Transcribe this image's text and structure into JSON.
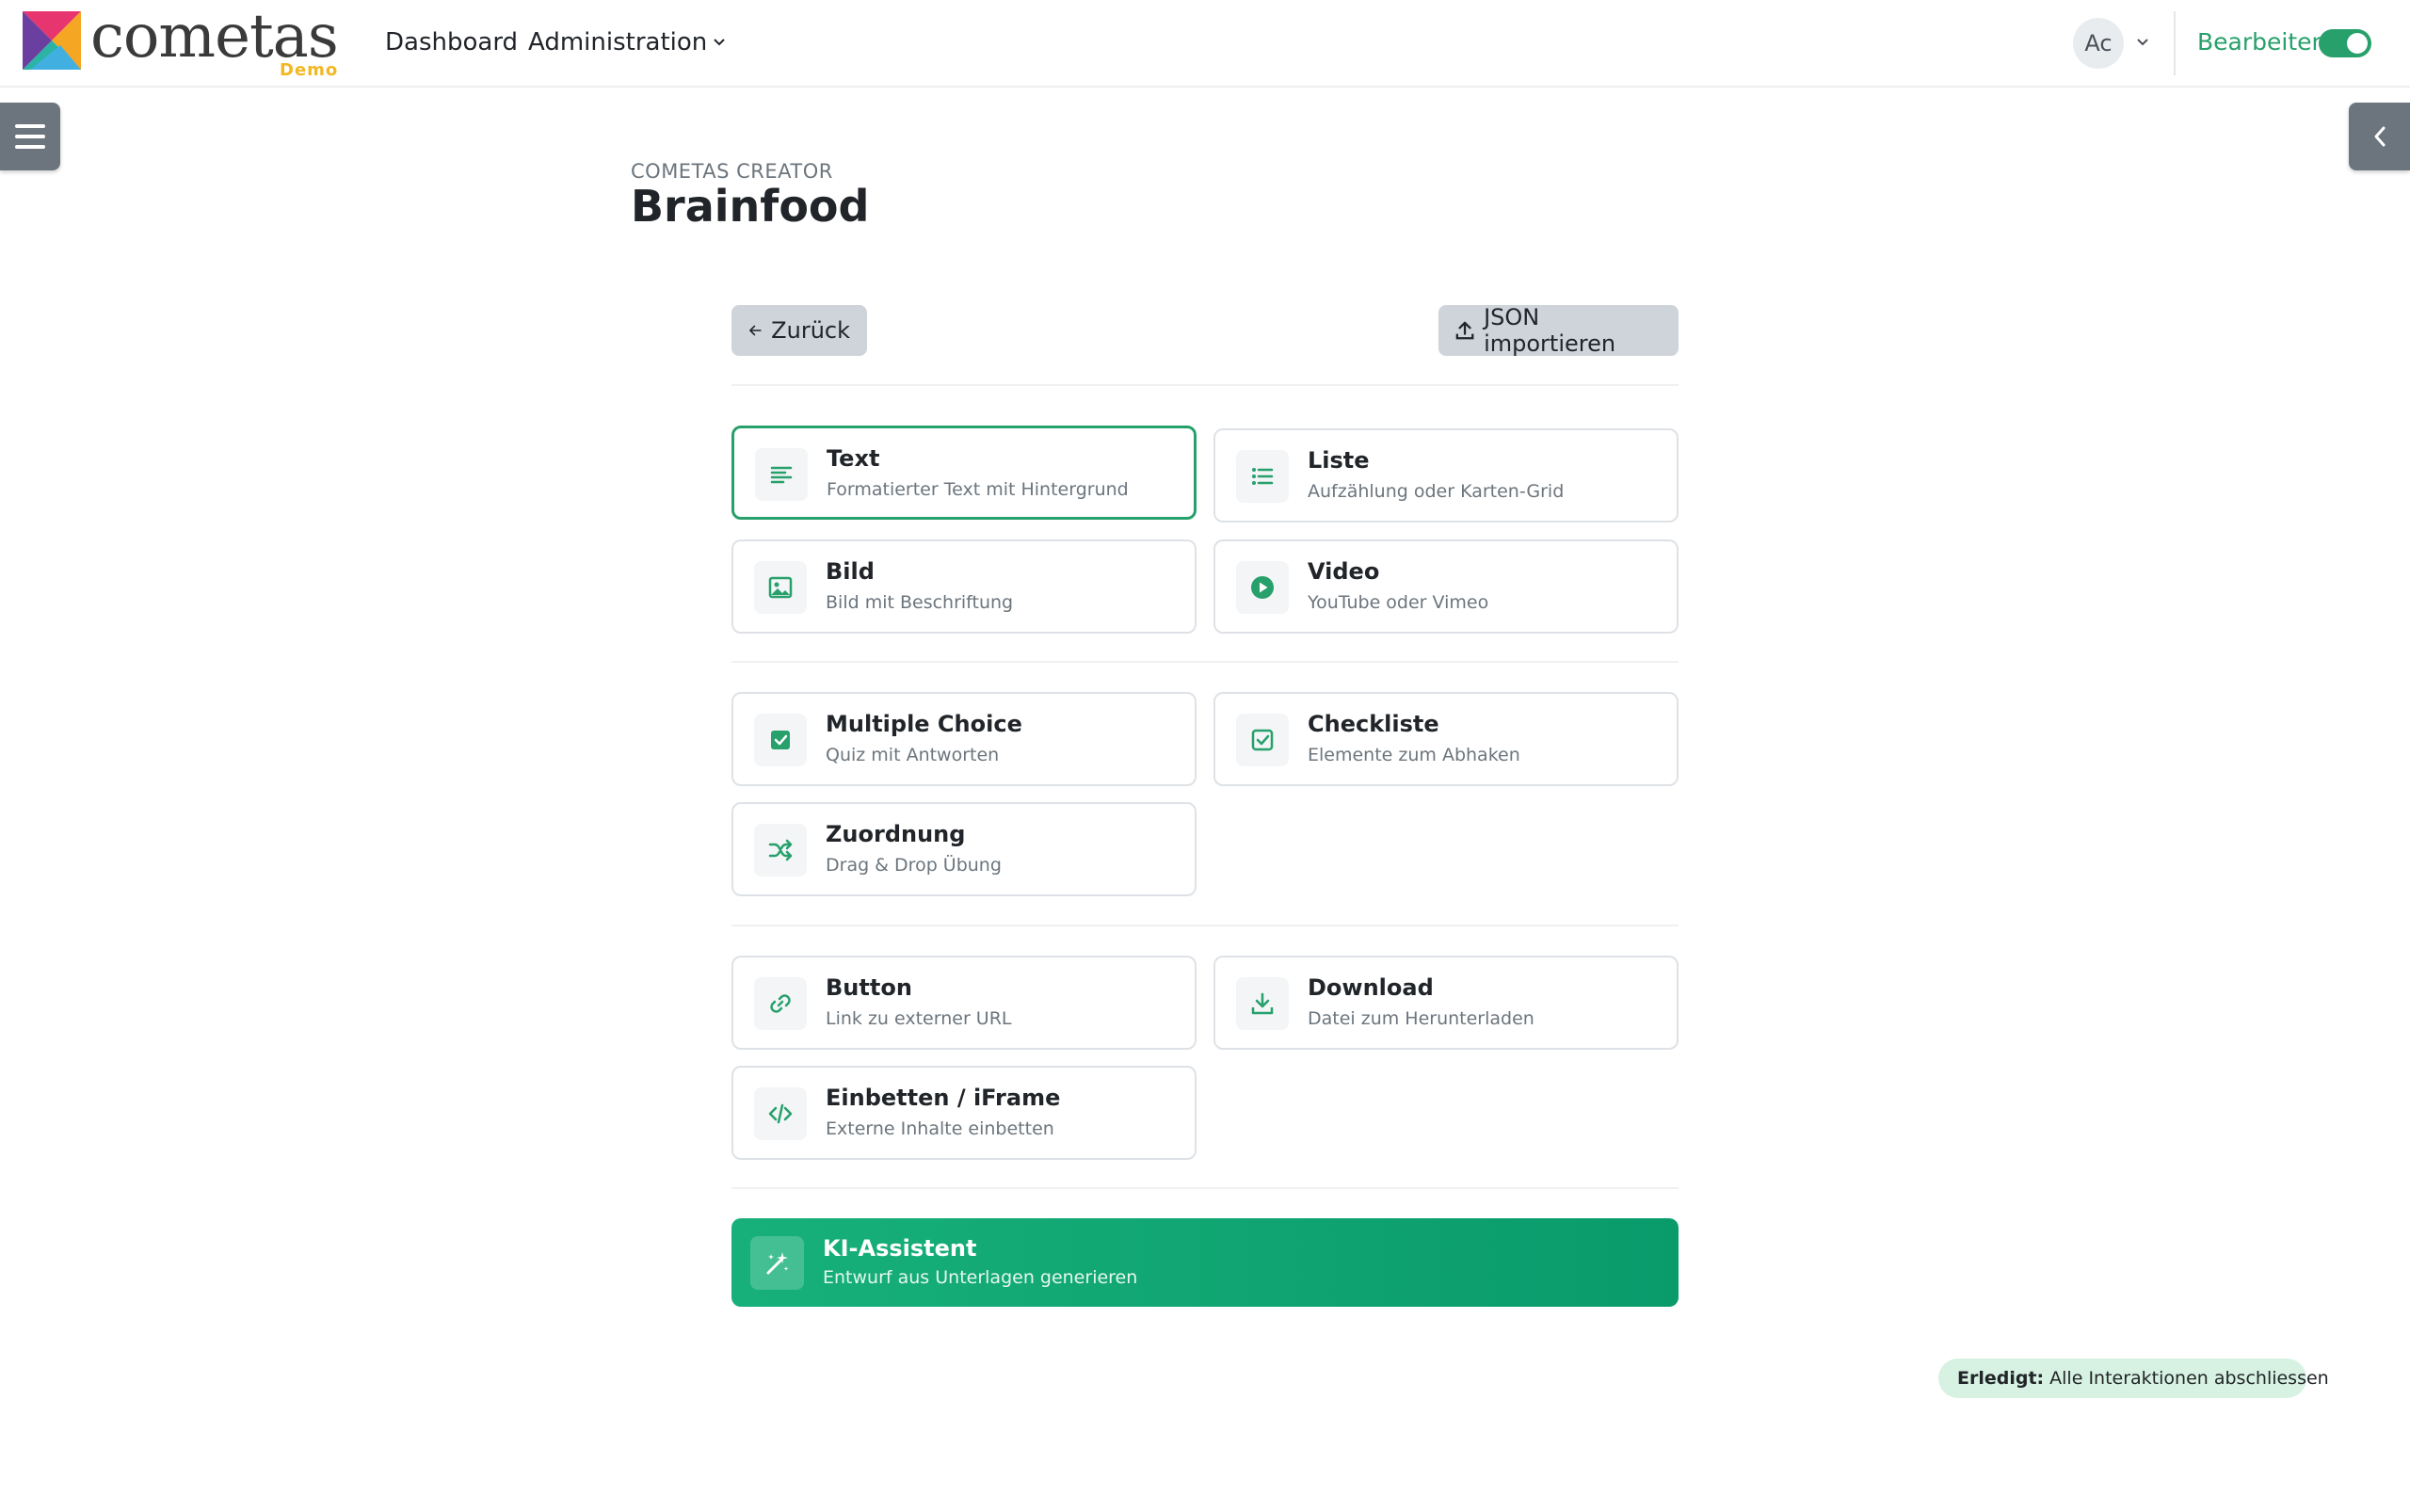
{
  "header": {
    "logo_text": "cometas",
    "logo_badge": "Demo",
    "nav": {
      "dashboard": "Dashboard",
      "administration": "Administration"
    },
    "user_initials": "Ac",
    "edit_label": "Bearbeiten",
    "edit_mode_on": true
  },
  "page": {
    "eyebrow": "COMETAS CREATOR",
    "title": "Brainfood"
  },
  "toolbar": {
    "back_label": "Zurück",
    "import_label": "JSON importieren"
  },
  "blocks": [
    {
      "title": "Text",
      "subtitle": "Formatierter Text mit Hintergrund",
      "icon": "align-left-icon",
      "selected": true
    },
    {
      "title": "Liste",
      "subtitle": "Aufzählung oder Karten-Grid",
      "icon": "list-icon"
    },
    {
      "title": "Bild",
      "subtitle": "Bild mit Beschriftung",
      "icon": "image-icon"
    },
    {
      "title": "Video",
      "subtitle": "YouTube oder Vimeo",
      "icon": "play-circle-icon"
    },
    {
      "title": "Multiple Choice",
      "subtitle": "Quiz mit Antworten",
      "icon": "check-square-filled-icon"
    },
    {
      "title": "Checkliste",
      "subtitle": "Elemente zum Abhaken",
      "icon": "check-square-icon"
    },
    {
      "title": "Zuordnung",
      "subtitle": "Drag & Drop Übung",
      "icon": "shuffle-icon"
    },
    {
      "title": "Button",
      "subtitle": "Link zu externer URL",
      "icon": "link-icon"
    },
    {
      "title": "Download",
      "subtitle": "Datei zum Herunterladen",
      "icon": "download-icon"
    },
    {
      "title": "Einbetten / iFrame",
      "subtitle": "Externe Inhalte einbetten",
      "icon": "code-icon"
    }
  ],
  "ai_assistant": {
    "title": "KI-Assistent",
    "subtitle": "Entwurf aus Unterlagen generieren",
    "icon": "magic-wand-icon"
  },
  "status": {
    "label": "Erledigt:",
    "text": "Alle Interaktionen abschliessen"
  },
  "colors": {
    "accent": "#27a06b",
    "ai_gradient_start": "#17b07a",
    "ai_gradient_end": "#0a9b6b",
    "logo_badge": "#f2b824",
    "side_handle": "#6c757d"
  }
}
